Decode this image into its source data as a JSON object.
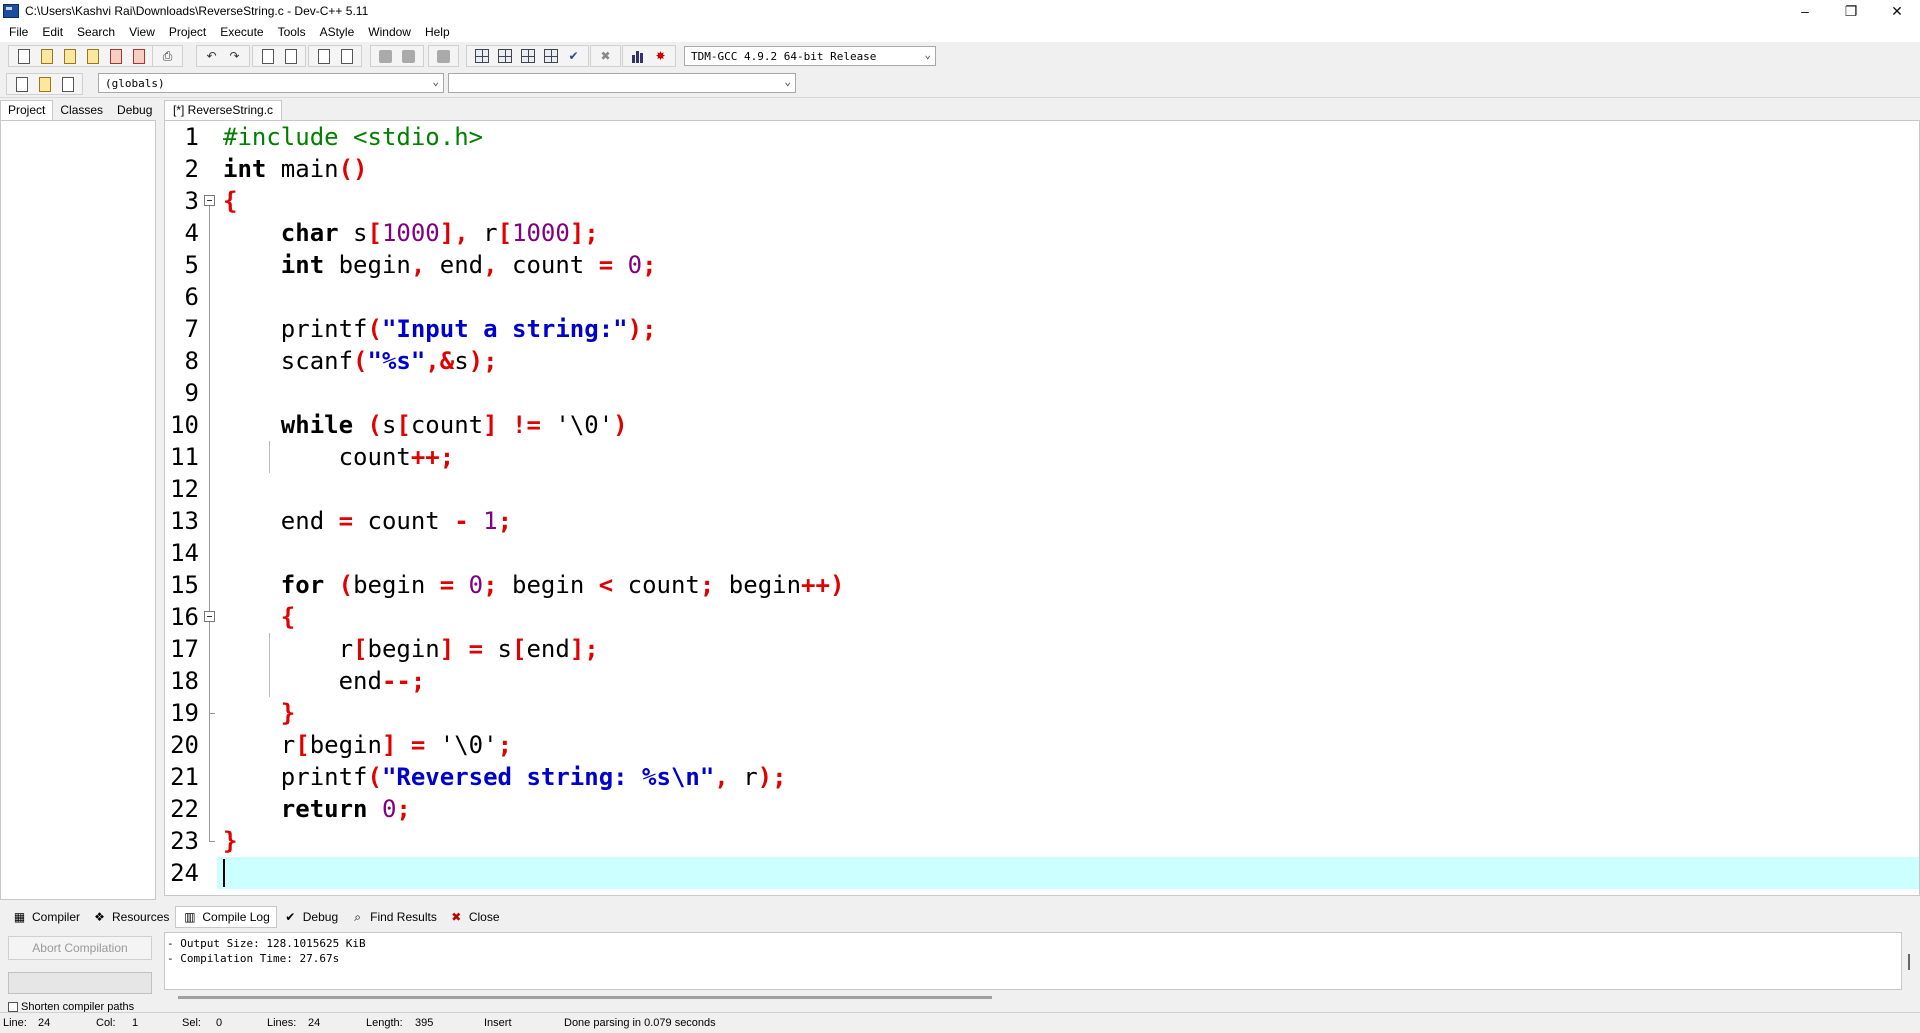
{
  "window": {
    "title": "C:\\Users\\Kashvi Rai\\Downloads\\ReverseString.c - Dev-C++ 5.11",
    "controls": {
      "minimize": "–",
      "restore": "❐",
      "close": "✕"
    }
  },
  "menu": [
    "File",
    "Edit",
    "Search",
    "View",
    "Project",
    "Execute",
    "Tools",
    "AStyle",
    "Window",
    "Help"
  ],
  "toolbar": {
    "compiler_select": "TDM-GCC 4.9.2 64-bit Release",
    "scope_select": "(globals)",
    "function_select": ""
  },
  "left_tabs": [
    "Project",
    "Classes",
    "Debug"
  ],
  "editor": {
    "tab_label": "[*] ReverseString.c",
    "current_line": 24,
    "lines": [
      [
        [
          "pp",
          "#include <stdio.h>"
        ]
      ],
      [
        [
          "kw",
          "int"
        ],
        [
          "",
          " main"
        ],
        [
          "sym",
          "()"
        ]
      ],
      [
        [
          "sym",
          "{"
        ]
      ],
      [
        [
          "",
          "    "
        ],
        [
          "kw",
          "char"
        ],
        [
          "",
          " s"
        ],
        [
          "sym",
          "["
        ],
        [
          "num",
          "1000"
        ],
        [
          "sym",
          "],"
        ],
        [
          "",
          " r"
        ],
        [
          "sym",
          "["
        ],
        [
          "num",
          "1000"
        ],
        [
          "sym",
          "];"
        ]
      ],
      [
        [
          "",
          "    "
        ],
        [
          "kw",
          "int"
        ],
        [
          "",
          " begin"
        ],
        [
          "sym",
          ","
        ],
        [
          "",
          " end"
        ],
        [
          "sym",
          ","
        ],
        [
          "",
          " count "
        ],
        [
          "sym",
          "="
        ],
        [
          "",
          " "
        ],
        [
          "num",
          "0"
        ],
        [
          "sym",
          ";"
        ]
      ],
      [],
      [
        [
          "",
          "    printf"
        ],
        [
          "sym",
          "("
        ],
        [
          "str",
          "\"Input a string:\""
        ],
        [
          "sym",
          ");"
        ]
      ],
      [
        [
          "",
          "    scanf"
        ],
        [
          "sym",
          "("
        ],
        [
          "str",
          "\"%s\""
        ],
        [
          "sym",
          ",&"
        ],
        [
          "",
          "s"
        ],
        [
          "sym",
          ");"
        ]
      ],
      [],
      [
        [
          "",
          "    "
        ],
        [
          "kw",
          "while"
        ],
        [
          "",
          " "
        ],
        [
          "sym",
          "("
        ],
        [
          "",
          "s"
        ],
        [
          "sym",
          "["
        ],
        [
          "",
          "count"
        ],
        [
          "sym",
          "]"
        ],
        [
          "",
          " "
        ],
        [
          "sym",
          "!="
        ],
        [
          "",
          " '\\0'"
        ],
        [
          "sym",
          ")"
        ]
      ],
      [
        [
          "",
          "        count"
        ],
        [
          "sym",
          "++;"
        ]
      ],
      [],
      [
        [
          "",
          "    end "
        ],
        [
          "sym",
          "="
        ],
        [
          "",
          " count "
        ],
        [
          "sym",
          "-"
        ],
        [
          "",
          " "
        ],
        [
          "num",
          "1"
        ],
        [
          "sym",
          ";"
        ]
      ],
      [],
      [
        [
          "",
          "    "
        ],
        [
          "kw",
          "for"
        ],
        [
          "",
          " "
        ],
        [
          "sym",
          "("
        ],
        [
          "",
          "begin "
        ],
        [
          "sym",
          "="
        ],
        [
          "",
          " "
        ],
        [
          "num",
          "0"
        ],
        [
          "sym",
          ";"
        ],
        [
          "",
          " begin "
        ],
        [
          "sym",
          "<"
        ],
        [
          "",
          " count"
        ],
        [
          "sym",
          ";"
        ],
        [
          "",
          " begin"
        ],
        [
          "sym",
          "++)"
        ]
      ],
      [
        [
          "",
          "    "
        ],
        [
          "sym",
          "{"
        ]
      ],
      [
        [
          "",
          "        r"
        ],
        [
          "sym",
          "["
        ],
        [
          "",
          "begin"
        ],
        [
          "sym",
          "]"
        ],
        [
          "",
          " "
        ],
        [
          "sym",
          "="
        ],
        [
          "",
          " s"
        ],
        [
          "sym",
          "["
        ],
        [
          "",
          "end"
        ],
        [
          "sym",
          "];"
        ]
      ],
      [
        [
          "",
          "        end"
        ],
        [
          "sym",
          "--;"
        ]
      ],
      [
        [
          "",
          "    "
        ],
        [
          "sym",
          "}"
        ]
      ],
      [
        [
          "",
          "    r"
        ],
        [
          "sym",
          "["
        ],
        [
          "",
          "begin"
        ],
        [
          "sym",
          "]"
        ],
        [
          "",
          " "
        ],
        [
          "sym",
          "="
        ],
        [
          "",
          " '\\0'"
        ],
        [
          "sym",
          ";"
        ]
      ],
      [
        [
          "",
          "    printf"
        ],
        [
          "sym",
          "("
        ],
        [
          "str",
          "\"Reversed string: %s\\n\""
        ],
        [
          "sym",
          ","
        ],
        [
          "",
          " r"
        ],
        [
          "sym",
          ");"
        ]
      ],
      [
        [
          "",
          "    "
        ],
        [
          "kw",
          "return"
        ],
        [
          "",
          " "
        ],
        [
          "num",
          "0"
        ],
        [
          "sym",
          ";"
        ]
      ],
      [
        [
          "sym",
          "}"
        ]
      ],
      []
    ]
  },
  "bottom_tabs": [
    {
      "label": "Compiler",
      "icon": "grid-icon"
    },
    {
      "label": "Resources",
      "icon": "resources-icon"
    },
    {
      "label": "Compile Log",
      "icon": "chart-icon"
    },
    {
      "label": "Debug",
      "icon": "check-icon"
    },
    {
      "label": "Find Results",
      "icon": "find-icon"
    },
    {
      "label": "Close",
      "icon": "close-icon"
    }
  ],
  "bottom_panel": {
    "abort_label": "Abort Compilation",
    "shorten_label": "Shorten compiler paths",
    "log": "- Output Size: 128.1015625 KiB\n- Compilation Time: 27.67s"
  },
  "status": {
    "line_label": "Line:",
    "line_value": "24",
    "col_label": "Col:",
    "col_value": "1",
    "sel_label": "Sel:",
    "sel_value": "0",
    "lines_label": "Lines:",
    "lines_value": "24",
    "length_label": "Length:",
    "length_value": "395",
    "mode": "Insert",
    "message": "Done parsing in 0.079 seconds"
  }
}
